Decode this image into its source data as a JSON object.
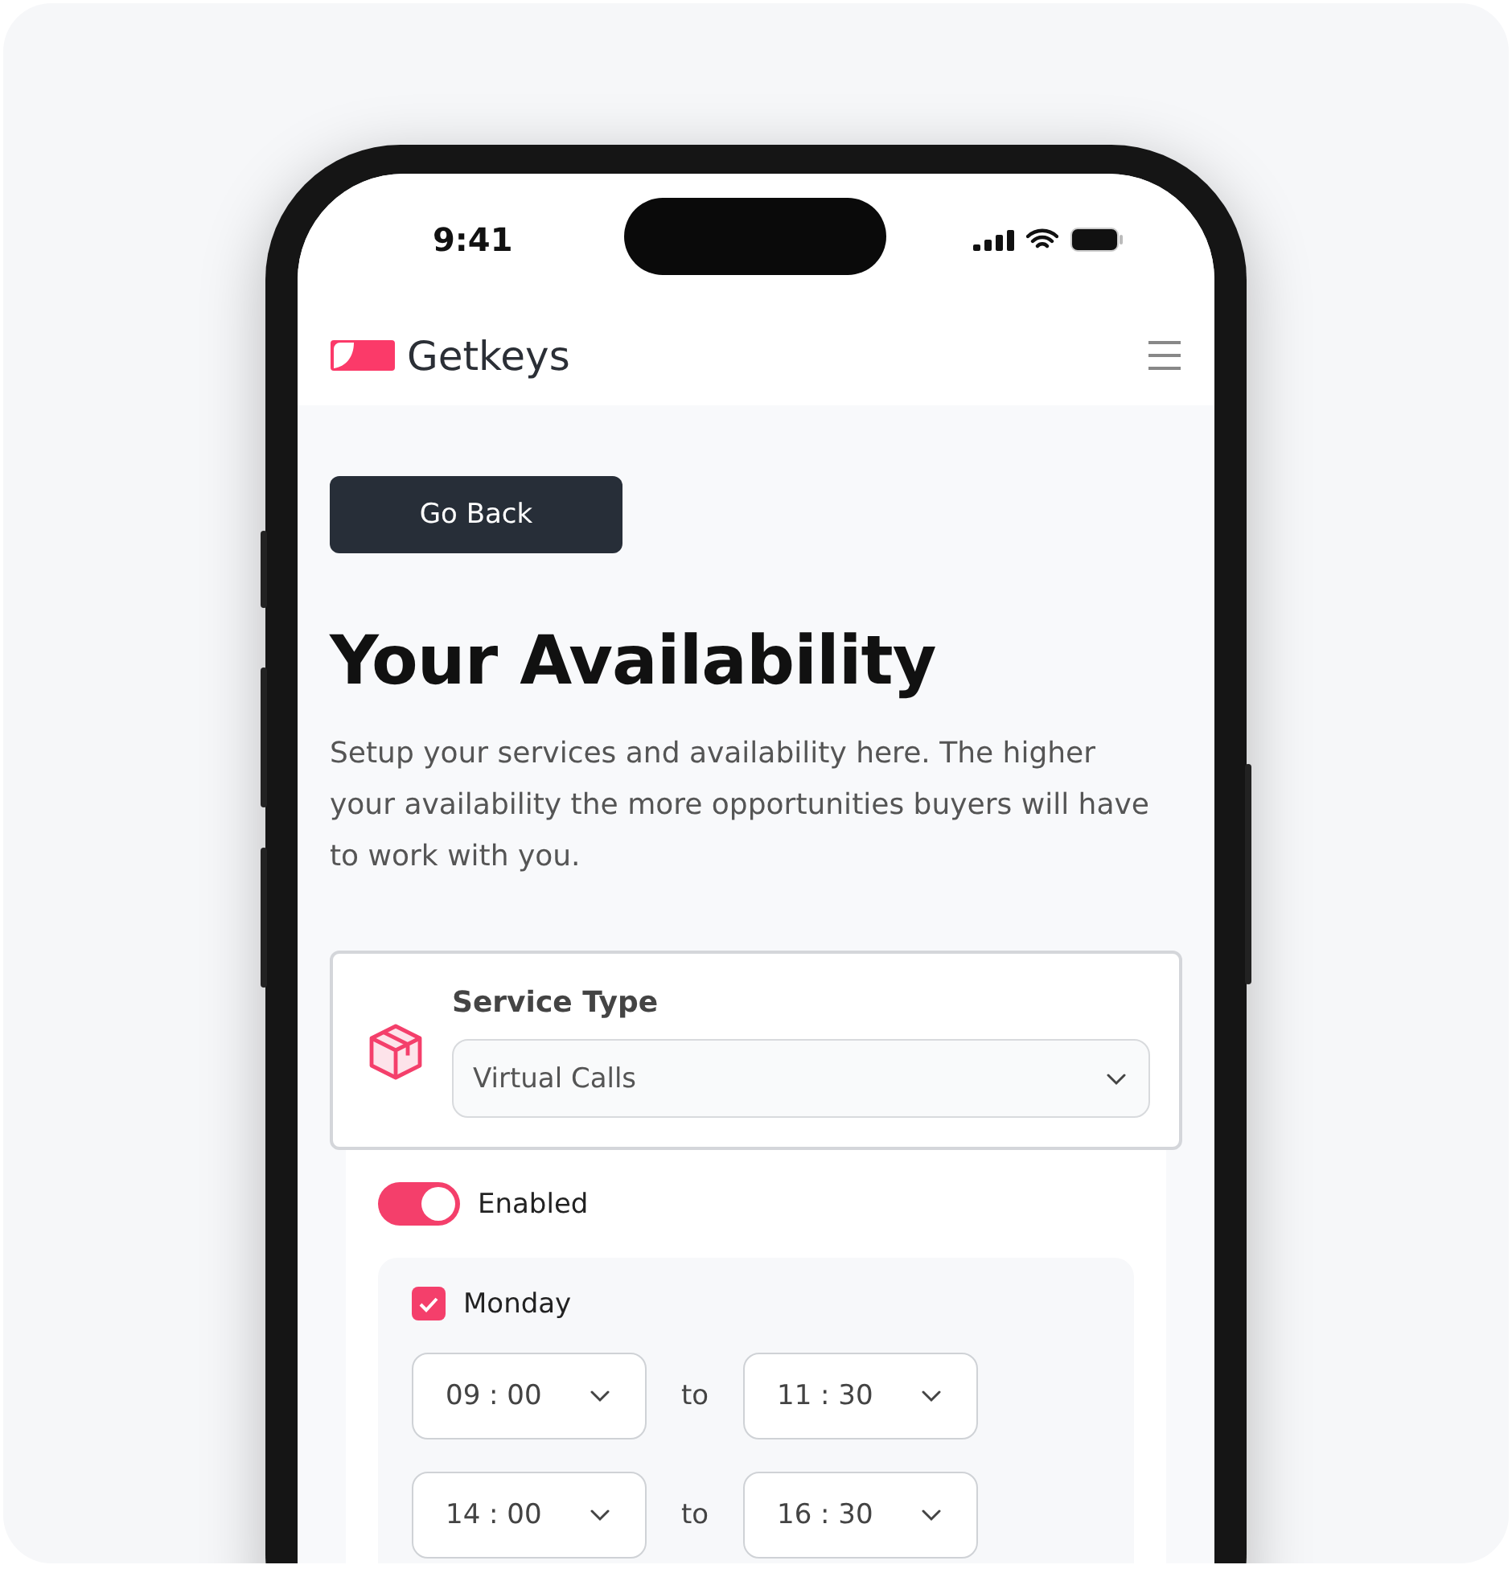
{
  "status_bar": {
    "time": "9:41"
  },
  "header": {
    "brand": "Getkeys"
  },
  "back_button": "Go Back",
  "title": "Your Availability",
  "description": "Setup your services and availability here. The higher your availability the more opportunities buyers will have to work with you.",
  "service": {
    "label": "Service Type",
    "value": "Virtual Calls"
  },
  "toggle": {
    "label": "Enabled",
    "on": true
  },
  "days": [
    {
      "name": "Monday",
      "checked": true,
      "slots": [
        {
          "start": "09 : 00",
          "joiner": "to",
          "end": "11 : 30"
        },
        {
          "start": "14 : 00",
          "joiner": "to",
          "end": "16 : 30"
        }
      ]
    }
  ]
}
